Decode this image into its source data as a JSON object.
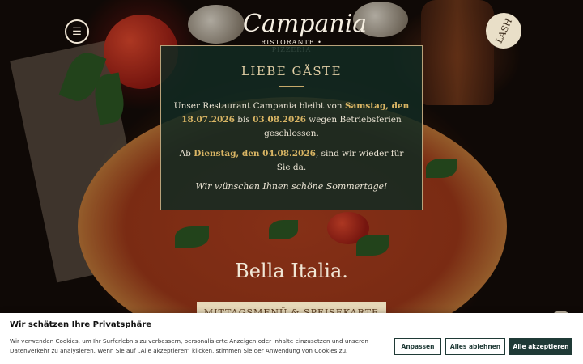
{
  "header": {
    "menu_icon": "hamburger-menu-icon",
    "logo_name": "Campania",
    "logo_tagline": "RISTORANTE • PIZZERIA",
    "badge_label": "LASH"
  },
  "notice": {
    "title": "LIEBE GÄSTE",
    "p1_text1": "Unser Restaurant Campania bleibt von ",
    "p1_bold1": "Samstag, den 18.07.2026",
    "p1_text2": " bis ",
    "p1_bold2": "03.08.2026",
    "p1_text3": " wegen Betriebsferien geschlossen.",
    "p2_text1": "Ab ",
    "p2_bold1": "Dienstag, den 04.08.2026",
    "p2_text2": ", sind wir wieder für Sie da.",
    "closing": "Wir wünschen Ihnen schöne Sommertage!"
  },
  "hero": {
    "tagline": "Bella Italia.",
    "menu_button": "MITTAGSMENÜ & SPEISEKARTE"
  },
  "cookie": {
    "title": "Wir schätzen Ihre Privatsphäre",
    "text": "Wir verwenden Cookies, um Ihr Surferlebnis zu verbessern, personalisierte Anzeigen oder Inhalte einzusetzen und unseren Datenverkehr zu analysieren. Wenn Sie auf „Alle akzeptieren“ klicken, stimmen Sie der Anwendung von Cookies zu.",
    "btn_customize": "Anpassen",
    "btn_reject": "Alles ablehnen",
    "btn_accept": "Alle akzeptieren"
  },
  "colors": {
    "notice_bg": "#122a22",
    "accent_gold": "#d9b564",
    "button_dark": "#1f3a36",
    "menu_button_bg": "#e6d8b8"
  }
}
